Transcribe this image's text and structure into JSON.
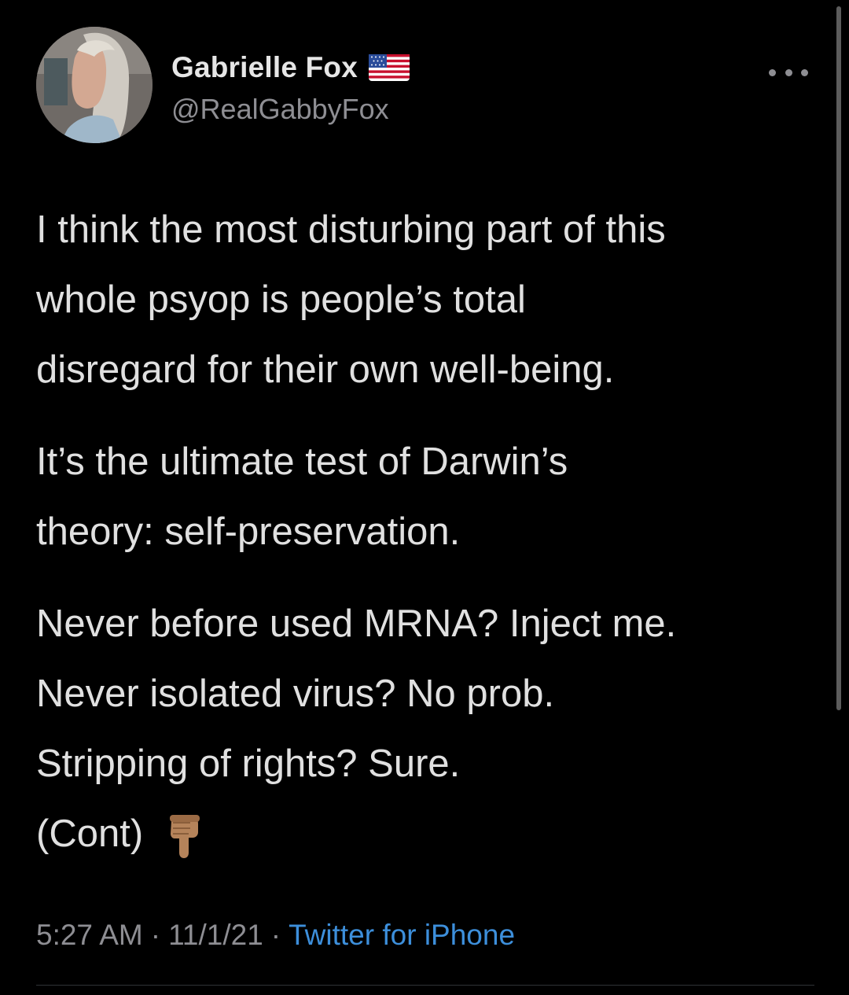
{
  "author": {
    "display_name": "Gabrielle Fox",
    "handle": "@RealGabbyFox",
    "flag_icon": "us-flag-icon",
    "avatar_icon": "profile-photo"
  },
  "more_icon": "more-options-icon",
  "tweet": {
    "paragraphs": [
      [
        "I think the most disturbing part of this",
        "whole psyop is people’s total",
        "disregard for their own well-being."
      ],
      [
        "It’s the ultimate test of Darwin’s",
        "theory: self-preservation."
      ],
      [
        "Never before used MRNA? Inject me.",
        "Never isolated virus? No prob.",
        "Stripping of rights? Sure.",
        "(Cont)"
      ]
    ],
    "trailing_emoji": "backhand-index-pointing-down-icon"
  },
  "meta": {
    "time": "5:27 AM",
    "separator": "·",
    "date": "11/1/21",
    "source": "Twitter for iPhone"
  },
  "colors": {
    "background": "#000000",
    "text": "#e0e0e0",
    "secondary": "#8e8e93",
    "link": "#3d8fdb"
  }
}
